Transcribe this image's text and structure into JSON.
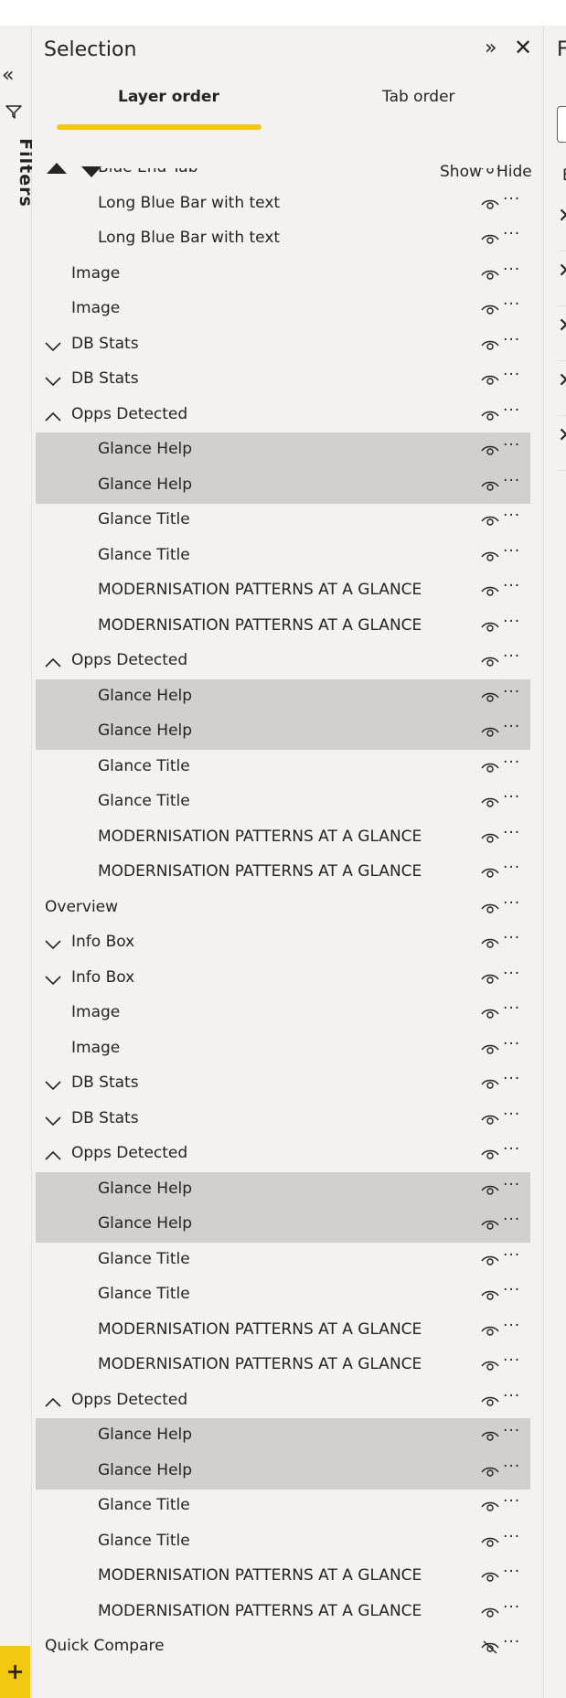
{
  "filters_rail": {
    "expand_icon": "double-chevron-left-icon",
    "filter_icon": "funnel-icon",
    "label": "Filters",
    "add_page_label": "+"
  },
  "selection_pane": {
    "title": "Selection",
    "collapse_icon": "double-chevron-right-icon",
    "close_icon": "close-icon",
    "tabs": [
      {
        "label": "Layer order",
        "active": true
      },
      {
        "label": "Tab order",
        "active": false
      }
    ],
    "toolbar": {
      "move_up_icon": "triangle-up-icon",
      "move_down_icon": "triangle-down-icon",
      "show_label": "Show",
      "hide_label": "Hide"
    },
    "more_label": "···",
    "accent_color": "#f2c811",
    "items": [
      {
        "label": "Blue End Tab",
        "indent": 2,
        "chevron": "none",
        "selected": false,
        "hidden": false
      },
      {
        "label": "Long Blue Bar with text",
        "indent": 2,
        "chevron": "none",
        "selected": false,
        "hidden": false
      },
      {
        "label": "Long Blue Bar with text",
        "indent": 2,
        "chevron": "none",
        "selected": false,
        "hidden": false
      },
      {
        "label": "Image",
        "indent": 1,
        "chevron": "none",
        "selected": false,
        "hidden": false
      },
      {
        "label": "Image",
        "indent": 1,
        "chevron": "none",
        "selected": false,
        "hidden": false
      },
      {
        "label": "DB Stats",
        "indent": 1,
        "chevron": "down",
        "selected": false,
        "hidden": false
      },
      {
        "label": "DB Stats",
        "indent": 1,
        "chevron": "down",
        "selected": false,
        "hidden": false
      },
      {
        "label": "Opps Detected",
        "indent": 1,
        "chevron": "up",
        "selected": false,
        "hidden": false
      },
      {
        "label": "Glance Help",
        "indent": 2,
        "chevron": "none",
        "selected": true,
        "hidden": false
      },
      {
        "label": "Glance Help",
        "indent": 2,
        "chevron": "none",
        "selected": true,
        "hidden": false
      },
      {
        "label": "Glance Title",
        "indent": 2,
        "chevron": "none",
        "selected": false,
        "hidden": false
      },
      {
        "label": "Glance Title",
        "indent": 2,
        "chevron": "none",
        "selected": false,
        "hidden": false
      },
      {
        "label": "MODERNISATION PATTERNS AT A GLANCE",
        "indent": 2,
        "chevron": "none",
        "selected": false,
        "hidden": false
      },
      {
        "label": "MODERNISATION PATTERNS AT A GLANCE",
        "indent": 2,
        "chevron": "none",
        "selected": false,
        "hidden": false
      },
      {
        "label": "Opps Detected",
        "indent": 1,
        "chevron": "up",
        "selected": false,
        "hidden": false
      },
      {
        "label": "Glance Help",
        "indent": 2,
        "chevron": "none",
        "selected": true,
        "hidden": false
      },
      {
        "label": "Glance Help",
        "indent": 2,
        "chevron": "none",
        "selected": true,
        "hidden": false
      },
      {
        "label": "Glance Title",
        "indent": 2,
        "chevron": "none",
        "selected": false,
        "hidden": false
      },
      {
        "label": "Glance Title",
        "indent": 2,
        "chevron": "none",
        "selected": false,
        "hidden": false
      },
      {
        "label": "MODERNISATION PATTERNS AT A GLANCE",
        "indent": 2,
        "chevron": "none",
        "selected": false,
        "hidden": false
      },
      {
        "label": "MODERNISATION PATTERNS AT A GLANCE",
        "indent": 2,
        "chevron": "none",
        "selected": false,
        "hidden": false
      },
      {
        "label": "Overview",
        "indent": 0,
        "chevron": "up",
        "selected": false,
        "hidden": false
      },
      {
        "label": "Info Box",
        "indent": 1,
        "chevron": "down",
        "selected": false,
        "hidden": false
      },
      {
        "label": "Info Box",
        "indent": 1,
        "chevron": "down",
        "selected": false,
        "hidden": false
      },
      {
        "label": "Image",
        "indent": 1,
        "chevron": "none",
        "selected": false,
        "hidden": false
      },
      {
        "label": "Image",
        "indent": 1,
        "chevron": "none",
        "selected": false,
        "hidden": false
      },
      {
        "label": "DB Stats",
        "indent": 1,
        "chevron": "down",
        "selected": false,
        "hidden": false
      },
      {
        "label": "DB Stats",
        "indent": 1,
        "chevron": "down",
        "selected": false,
        "hidden": false
      },
      {
        "label": "Opps Detected",
        "indent": 1,
        "chevron": "up",
        "selected": false,
        "hidden": false
      },
      {
        "label": "Glance Help",
        "indent": 2,
        "chevron": "none",
        "selected": true,
        "hidden": false
      },
      {
        "label": "Glance Help",
        "indent": 2,
        "chevron": "none",
        "selected": true,
        "hidden": false
      },
      {
        "label": "Glance Title",
        "indent": 2,
        "chevron": "none",
        "selected": false,
        "hidden": false
      },
      {
        "label": "Glance Title",
        "indent": 2,
        "chevron": "none",
        "selected": false,
        "hidden": false
      },
      {
        "label": "MODERNISATION PATTERNS AT A GLANCE",
        "indent": 2,
        "chevron": "none",
        "selected": false,
        "hidden": false
      },
      {
        "label": "MODERNISATION PATTERNS AT A GLANCE",
        "indent": 2,
        "chevron": "none",
        "selected": false,
        "hidden": false
      },
      {
        "label": "Opps Detected",
        "indent": 1,
        "chevron": "up",
        "selected": false,
        "hidden": false
      },
      {
        "label": "Glance Help",
        "indent": 2,
        "chevron": "none",
        "selected": true,
        "hidden": false
      },
      {
        "label": "Glance Help",
        "indent": 2,
        "chevron": "none",
        "selected": true,
        "hidden": false
      },
      {
        "label": "Glance Title",
        "indent": 2,
        "chevron": "none",
        "selected": false,
        "hidden": false
      },
      {
        "label": "Glance Title",
        "indent": 2,
        "chevron": "none",
        "selected": false,
        "hidden": false
      },
      {
        "label": "MODERNISATION PATTERNS AT A GLANCE",
        "indent": 2,
        "chevron": "none",
        "selected": false,
        "hidden": false
      },
      {
        "label": "MODERNISATION PATTERNS AT A GLANCE",
        "indent": 2,
        "chevron": "none",
        "selected": false,
        "hidden": false
      },
      {
        "label": "Quick Compare",
        "indent": 0,
        "chevron": "down",
        "selected": false,
        "hidden": true
      }
    ]
  },
  "right_panel": {
    "title_letter": "F",
    "sub_letter": "E",
    "item_icon": "close-icon"
  }
}
